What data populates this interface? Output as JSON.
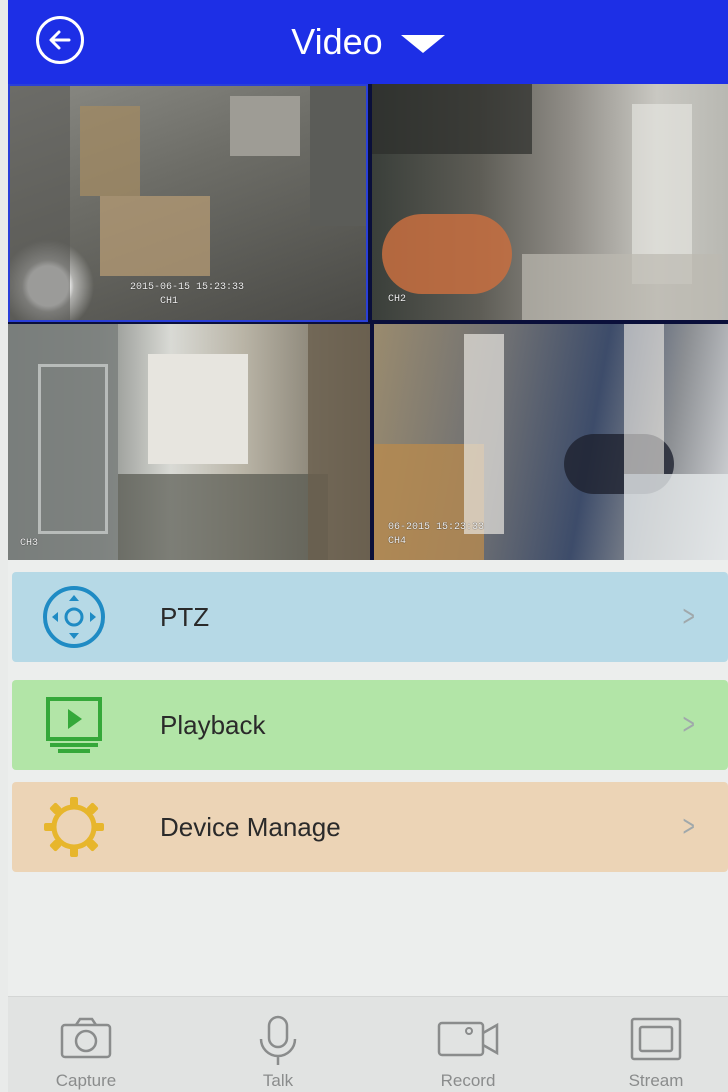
{
  "header": {
    "title": "Video",
    "back_icon": "back-arrow-icon",
    "dropdown_icon": "triangle-down-icon",
    "color": "#1d2fe6"
  },
  "cameras": [
    {
      "id_label": "CH1",
      "timestamp": "2015-06-15 15:23:33",
      "note": ""
    },
    {
      "id_label": "CH2",
      "timestamp": "",
      "note": ""
    },
    {
      "id_label": "CH3",
      "timestamp": "",
      "note": ""
    },
    {
      "id_label": "CH4",
      "timestamp": "",
      "note": "06-2015 15:23:33"
    }
  ],
  "menu": {
    "items": [
      {
        "label": "PTZ",
        "icon": "ptz-joystick-icon",
        "color": "#b6d9e6"
      },
      {
        "label": "Playback",
        "icon": "monitor-play-icon",
        "color": "#b2e5a7"
      },
      {
        "label": "Device Manage",
        "icon": "gear-icon",
        "color": "#ecd4b6"
      }
    ],
    "chevron": ">"
  },
  "toolbar": {
    "items": [
      {
        "label": "Capture",
        "icon": "camera-icon"
      },
      {
        "label": "Talk",
        "icon": "microphone-icon"
      },
      {
        "label": "Record",
        "icon": "video-camera-icon"
      },
      {
        "label": "Stream",
        "icon": "stream-frame-icon"
      }
    ]
  }
}
